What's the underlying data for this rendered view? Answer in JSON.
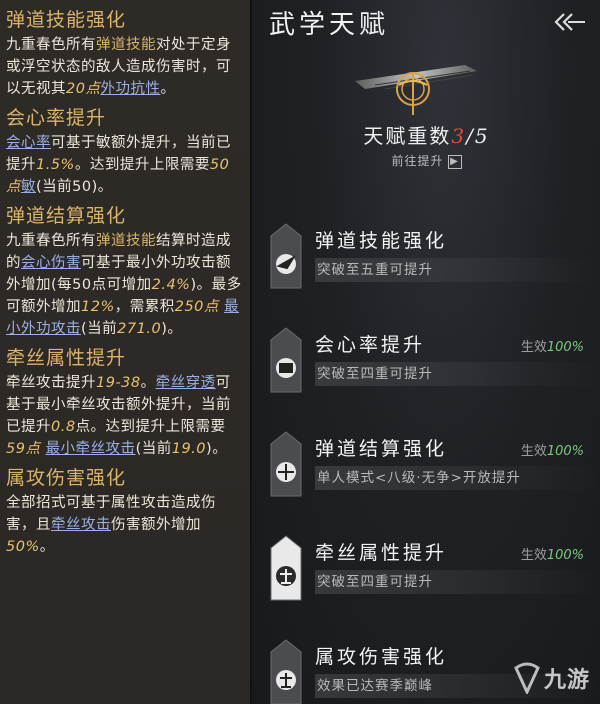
{
  "left": {
    "sections": [
      {
        "title": "弹道技能强化",
        "body": [
          {
            "t": "九重春色所有",
            "c": ""
          },
          {
            "t": "弹道技能",
            "c": "hl"
          },
          {
            "t": "对处于定身或浮空状态的敌人造成伤害时，可以无视其",
            "c": ""
          },
          {
            "t": "20点",
            "c": "num"
          },
          {
            "t": "外功抗性",
            "c": "lk"
          },
          {
            "t": "。",
            "c": ""
          }
        ]
      },
      {
        "title": "会心率提升",
        "body": [
          {
            "t": "会心率",
            "c": "lk"
          },
          {
            "t": "可基于敏额外提升，当前已提升",
            "c": ""
          },
          {
            "t": "1.5%",
            "c": "num"
          },
          {
            "t": "。达到提升上限需要",
            "c": ""
          },
          {
            "t": "50点",
            "c": "num"
          },
          {
            "t": "敏",
            "c": "lk"
          },
          {
            "t": "(当前50)。",
            "c": ""
          }
        ]
      },
      {
        "title": "弹道结算强化",
        "body": [
          {
            "t": "九重春色所有",
            "c": ""
          },
          {
            "t": "弹道技能",
            "c": "hl"
          },
          {
            "t": "结算时造成的",
            "c": ""
          },
          {
            "t": "会心伤害",
            "c": "lk"
          },
          {
            "t": "可基于最小外功攻击额外增加(每50点可增加",
            "c": ""
          },
          {
            "t": "2.4%",
            "c": "num"
          },
          {
            "t": ")。最多可额外增加",
            "c": ""
          },
          {
            "t": "12%",
            "c": "num"
          },
          {
            "t": "，需累积",
            "c": ""
          },
          {
            "t": "250点",
            "c": "num"
          },
          {
            "t": " ",
            "c": ""
          },
          {
            "t": "最小外功攻击",
            "c": "lk"
          },
          {
            "t": "(当前",
            "c": ""
          },
          {
            "t": "271.0",
            "c": "num"
          },
          {
            "t": ")。",
            "c": ""
          }
        ]
      },
      {
        "title": "牵丝属性提升",
        "body": [
          {
            "t": "牵丝攻击提升",
            "c": ""
          },
          {
            "t": "19-38",
            "c": "num"
          },
          {
            "t": "。",
            "c": ""
          },
          {
            "t": "牵丝穿透",
            "c": "lk"
          },
          {
            "t": "可基于最小牵丝攻击额外提升，当前已提升",
            "c": ""
          },
          {
            "t": "0.8",
            "c": "num"
          },
          {
            "t": "点。达到提升上限需要",
            "c": ""
          },
          {
            "t": "59点",
            "c": "num"
          },
          {
            "t": " ",
            "c": ""
          },
          {
            "t": "最小牵丝攻击",
            "c": "lk"
          },
          {
            "t": "(当前",
            "c": ""
          },
          {
            "t": "19.0",
            "c": "num"
          },
          {
            "t": ")。",
            "c": ""
          }
        ]
      },
      {
        "title": "属攻伤害强化",
        "body": [
          {
            "t": "全部招式可基于属性攻击造成伤害，且",
            "c": ""
          },
          {
            "t": "牵丝攻击",
            "c": "lk"
          },
          {
            "t": "伤害额外增加",
            "c": ""
          },
          {
            "t": "50%",
            "c": "num"
          },
          {
            "t": "。",
            "c": ""
          }
        ]
      }
    ]
  },
  "right": {
    "title": "武学天赋",
    "rank_label": "天赋重数",
    "rank_current": "3",
    "rank_sep": "/",
    "rank_max": "5",
    "goto_label": "前往提升",
    "goto_arrow": "▶",
    "talents": [
      {
        "title": "弹道技能强化",
        "status": "",
        "pct": "",
        "sub": "突破至五重可提升"
      },
      {
        "title": "会心率提升",
        "status": "生效",
        "pct": "100%",
        "sub": "突破至四重可提升"
      },
      {
        "title": "弹道结算强化",
        "status": "生效",
        "pct": "100%",
        "sub": "单人模式<八级·无争>开放提升"
      },
      {
        "title": "牵丝属性提升",
        "status": "生效",
        "pct": "100%",
        "sub": "突破至四重可提升"
      },
      {
        "title": "属攻伤害强化",
        "status": "",
        "pct": "",
        "sub": "效果已达赛季巅峰"
      }
    ]
  },
  "watermark": {
    "text": "九游"
  },
  "colors": {
    "gold": "#d9b46a",
    "link": "#9ab0e6",
    "red": "#e04a3a",
    "green": "#7ec982"
  }
}
